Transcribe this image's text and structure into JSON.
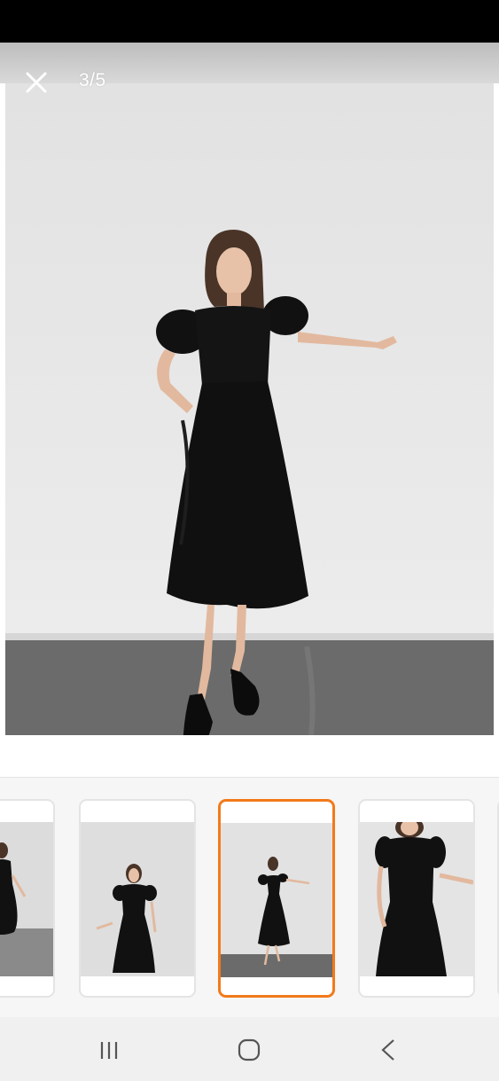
{
  "viewer": {
    "counter": "3/5",
    "close_icon": "close-icon"
  },
  "thumbnails": [
    {
      "name": "thumbnail-2",
      "selected": false
    },
    {
      "name": "thumbnail-3",
      "selected": false
    },
    {
      "name": "thumbnail-4",
      "selected": true
    },
    {
      "name": "thumbnail-5",
      "selected": false
    }
  ],
  "nav": {
    "recents_icon": "recents-icon",
    "home_icon": "home-icon",
    "back_icon": "back-icon"
  },
  "colors": {
    "accent": "#f27a1a",
    "status_bar": "#000000",
    "dress": "#111111",
    "wall": "#e6e6e6",
    "floor": "#6b6b6b"
  }
}
